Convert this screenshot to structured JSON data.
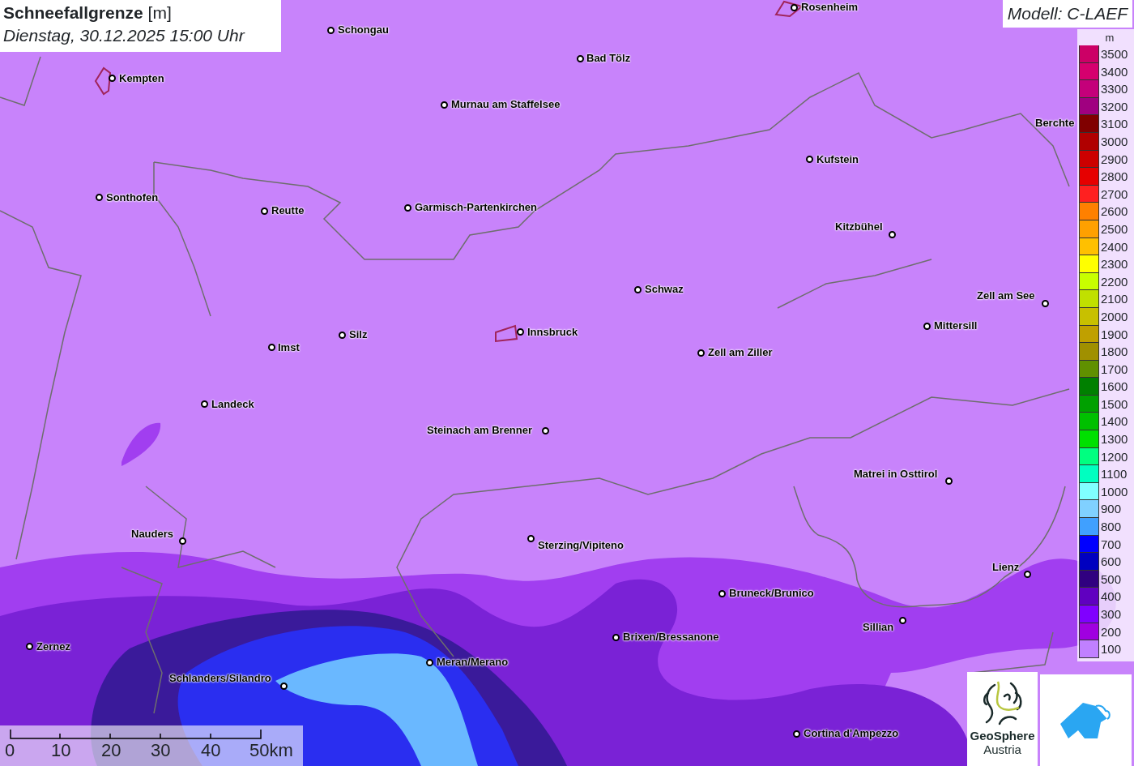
{
  "title": {
    "parameter": "Schneefallgrenze",
    "unit": "[m]",
    "datetime": "Dienstag, 30.12.2025 15:00 Uhr"
  },
  "model": "Modell: C-LAEF",
  "cities": [
    {
      "name": "Schongau"
    },
    {
      "name": "Rosenheim"
    },
    {
      "name": "Bad Tölz"
    },
    {
      "name": "Kempten"
    },
    {
      "name": "Murnau am Staffelsee"
    },
    {
      "name": "Berchte"
    },
    {
      "name": "Kufstein"
    },
    {
      "name": "Sonthofen"
    },
    {
      "name": "Reutte"
    },
    {
      "name": "Garmisch-Partenkirchen"
    },
    {
      "name": "Kitzbühel"
    },
    {
      "name": "Schwaz"
    },
    {
      "name": "Zell am See"
    },
    {
      "name": "Mittersill"
    },
    {
      "name": "Innsbruck"
    },
    {
      "name": "Silz"
    },
    {
      "name": "Imst"
    },
    {
      "name": "Zell am Ziller"
    },
    {
      "name": "Landeck"
    },
    {
      "name": "Steinach am Brenner"
    },
    {
      "name": "Matrei in Osttirol"
    },
    {
      "name": "Nauders"
    },
    {
      "name": "Sterzing/Vipiteno"
    },
    {
      "name": "Lienz"
    },
    {
      "name": "Bruneck/Brunico"
    },
    {
      "name": "Sillian"
    },
    {
      "name": "Brixen/Bressanone"
    },
    {
      "name": "Zernez"
    },
    {
      "name": "Meran/Merano"
    },
    {
      "name": "Schlanders/Silandro"
    },
    {
      "name": "Cortina d'Ampezzo"
    }
  ],
  "legend": {
    "unit": "m",
    "items": [
      {
        "label": "3500",
        "color": "#cc0066"
      },
      {
        "label": "3400",
        "color": "#d6006e"
      },
      {
        "label": "3300",
        "color": "#c4007a"
      },
      {
        "label": "3200",
        "color": "#a00080"
      },
      {
        "label": "3100",
        "color": "#800000"
      },
      {
        "label": "3000",
        "color": "#b00000"
      },
      {
        "label": "2900",
        "color": "#cc0000"
      },
      {
        "label": "2800",
        "color": "#e60000"
      },
      {
        "label": "2700",
        "color": "#ff2020"
      },
      {
        "label": "2600",
        "color": "#ff8000"
      },
      {
        "label": "2500",
        "color": "#ffa000"
      },
      {
        "label": "2400",
        "color": "#ffc000"
      },
      {
        "label": "2300",
        "color": "#ffff00"
      },
      {
        "label": "2200",
        "color": "#c8ff00"
      },
      {
        "label": "2100",
        "color": "#c0e000"
      },
      {
        "label": "2000",
        "color": "#c8c000"
      },
      {
        "label": "1900",
        "color": "#c0a000"
      },
      {
        "label": "1800",
        "color": "#a09000"
      },
      {
        "label": "1700",
        "color": "#609000"
      },
      {
        "label": "1600",
        "color": "#008000"
      },
      {
        "label": "1500",
        "color": "#00a000"
      },
      {
        "label": "1400",
        "color": "#00c000"
      },
      {
        "label": "1300",
        "color": "#00e000"
      },
      {
        "label": "1200",
        "color": "#00ff80"
      },
      {
        "label": "1100",
        "color": "#00ffc0"
      },
      {
        "label": "1000",
        "color": "#80ffff"
      },
      {
        "label": "900",
        "color": "#80d0ff"
      },
      {
        "label": "800",
        "color": "#40a0ff"
      },
      {
        "label": "700",
        "color": "#0000ff"
      },
      {
        "label": "600",
        "color": "#0000c0"
      },
      {
        "label": "500",
        "color": "#300080"
      },
      {
        "label": "400",
        "color": "#6000c0"
      },
      {
        "label": "300",
        "color": "#8000ff"
      },
      {
        "label": "200",
        "color": "#a000e0"
      },
      {
        "label": "100",
        "color": "#c080ff"
      }
    ]
  },
  "scale_bar": {
    "labels": [
      "0",
      "10",
      "20",
      "30",
      "40",
      "50km"
    ]
  },
  "logo": {
    "line1": "GeoSphere",
    "line2": "Austria"
  }
}
